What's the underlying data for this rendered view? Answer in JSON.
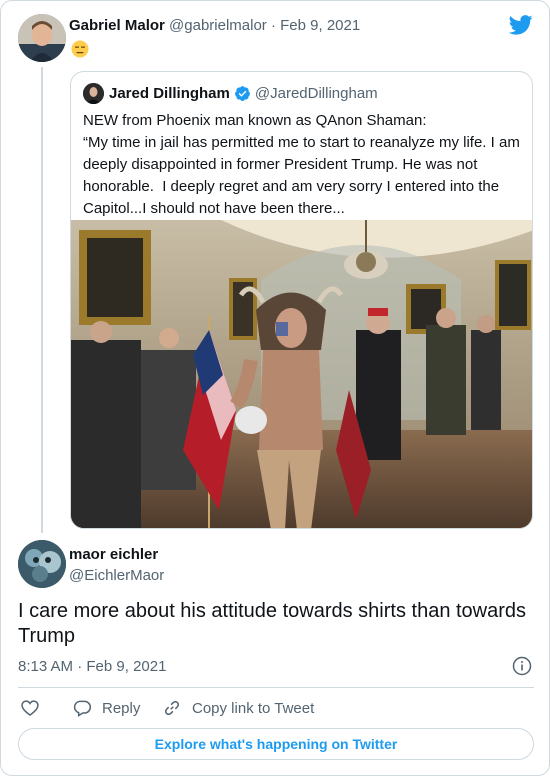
{
  "tweet": {
    "author_name": "Gabriel Malor",
    "author_handle": "@gabrielmalor",
    "separator": "·",
    "date": "Feb 9, 2021",
    "icon": "expressionless-emoji"
  },
  "quoted": {
    "author_name": "Jared Dillingham",
    "author_handle": "@JaredDillingham",
    "verified": true,
    "text": "NEW from Phoenix man known as QAnon Shaman:\n“My time in jail has permitted me to start to reanalyze my life. I am deeply disappointed in former President Trump. He was not honorable.  I deeply regret and am very sorry I entered into the Capitol...I should not have been there...",
    "photo_icon": "news-photo"
  },
  "reply": {
    "author_name": "maor eichler",
    "author_handle": "@EichlerMaor",
    "text": "I care more about his attitude towards shirts than towards Trump",
    "time": "8:13 AM",
    "date": "Feb 9, 2021"
  },
  "actions": {
    "reply_label": "Reply",
    "copy_label": "Copy link to Tweet"
  },
  "footer": {
    "explore_label": "Explore what's happening on Twitter"
  },
  "colors": {
    "twitter_blue": "#1d9bf0",
    "text": "#0f1419",
    "muted": "#536471",
    "border": "#cfd9de",
    "like_red": "#536471"
  }
}
